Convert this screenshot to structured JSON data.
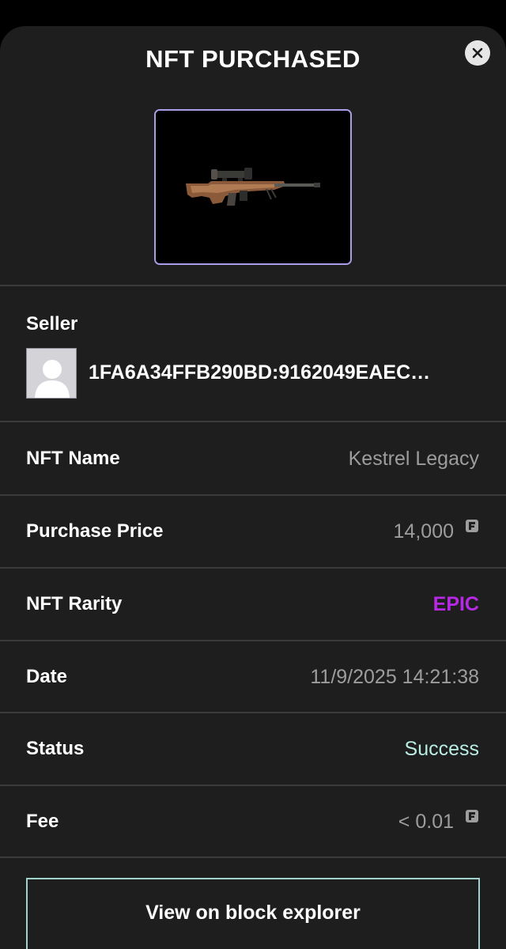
{
  "modal": {
    "title": "NFT PURCHASED",
    "close_icon": "close-icon"
  },
  "nft_image": {
    "icon": "sniper-rifle-image"
  },
  "seller": {
    "label": "Seller",
    "avatar_icon": "user-avatar-placeholder",
    "address": "1FA6A34FFB290BD:9162049EAEC…"
  },
  "details": {
    "nft_name": {
      "label": "NFT Name",
      "value": "Kestrel Legacy"
    },
    "purchase_price": {
      "label": "Purchase Price",
      "value": "14,000",
      "icon": "coin-icon"
    },
    "nft_rarity": {
      "label": "NFT Rarity",
      "value": "EPIC",
      "color": "#b829e6"
    },
    "date": {
      "label": "Date",
      "value": "11/9/2025 14:21:38"
    },
    "status": {
      "label": "Status",
      "value": "Success",
      "color": "#b9ece2"
    },
    "fee": {
      "label": "Fee",
      "value": "< 0.01",
      "icon": "coin-icon"
    }
  },
  "actions": {
    "explorer_button": "View on block explorer"
  },
  "colors": {
    "background": "#000000",
    "sheet": "#1e1e1e",
    "divider": "#3b3b3b",
    "accent_frame": "#a99ee8",
    "button_border": "#9fd3cb",
    "muted_text": "#9d9d9d"
  }
}
